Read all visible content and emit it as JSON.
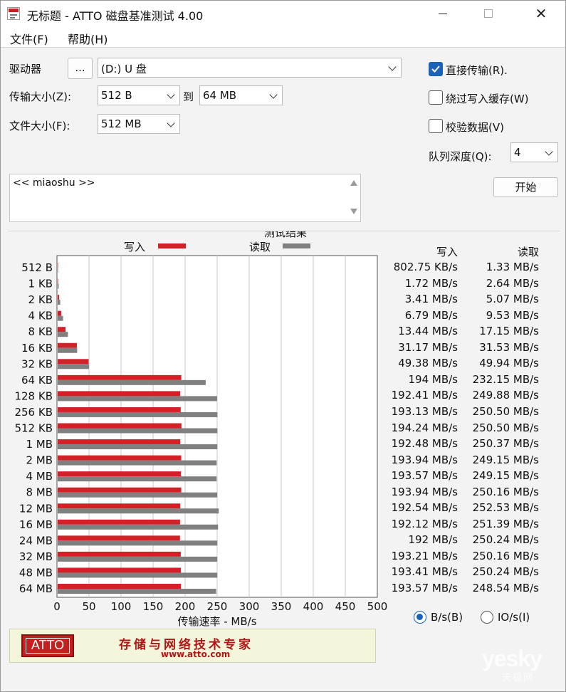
{
  "window": {
    "title": "无标题 - ATTO 磁盘基准测试 4.00",
    "close_glyph": "✕"
  },
  "menu": {
    "file": "文件(F)",
    "help": "帮助(H)"
  },
  "settings": {
    "drive_label": "驱动器",
    "browse_label": "...",
    "drive_value": "(D:) U 盘",
    "transfer_size_label": "传输大小(Z):",
    "transfer_from": "512 B",
    "to_label": "到",
    "transfer_to": "64 MB",
    "file_size_label": "文件大小(F):",
    "file_size": "512 MB",
    "direct_io_label": "直接传输(R).",
    "direct_io_checked": true,
    "bypass_cache_label": "绕过写入缓存(W)",
    "bypass_cache_checked": false,
    "verify_label": "校验数据(V)",
    "verify_checked": false,
    "queue_depth_label": "队列深度(Q):",
    "queue_depth": "4",
    "start_label": "开始"
  },
  "description": "<< miaoshu >>",
  "results": {
    "title": "测试结果",
    "write_header": "写入",
    "read_header": "读取",
    "unit_bs_label": "B/s(B)",
    "unit_ios_label": "IO/s(I)",
    "unit_selected": "B/s"
  },
  "chart_data": {
    "type": "bar",
    "orientation": "horizontal",
    "title": "测试结果",
    "xlabel": "传输速率 - MB/s",
    "xlim": [
      0,
      500
    ],
    "xticks": [
      0,
      50,
      100,
      150,
      200,
      250,
      300,
      350,
      400,
      450,
      500
    ],
    "grid": true,
    "legend": "top",
    "categories": [
      "512 B",
      "1 KB",
      "2 KB",
      "4 KB",
      "8 KB",
      "16 KB",
      "32 KB",
      "64 KB",
      "128 KB",
      "256 KB",
      "512 KB",
      "1 MB",
      "2 MB",
      "4 MB",
      "8 MB",
      "12 MB",
      "16 MB",
      "24 MB",
      "32 MB",
      "48 MB",
      "64 MB"
    ],
    "series": [
      {
        "name": "写入",
        "color": "#d42027",
        "values": [
          0.78,
          1.72,
          3.41,
          6.79,
          13.44,
          31.17,
          49.38,
          194,
          192.41,
          193.13,
          194.24,
          192.48,
          193.94,
          193.57,
          193.94,
          192.54,
          192.12,
          192,
          193.21,
          193.41,
          193.57
        ],
        "labels": [
          "802.75 KB/s",
          "1.72 MB/s",
          "3.41 MB/s",
          "6.79 MB/s",
          "13.44 MB/s",
          "31.17 MB/s",
          "49.38 MB/s",
          "194 MB/s",
          "192.41 MB/s",
          "193.13 MB/s",
          "194.24 MB/s",
          "192.48 MB/s",
          "193.94 MB/s",
          "193.57 MB/s",
          "193.94 MB/s",
          "192.54 MB/s",
          "192.12 MB/s",
          "192 MB/s",
          "193.21 MB/s",
          "193.41 MB/s",
          "193.57 MB/s"
        ]
      },
      {
        "name": "读取",
        "color": "#808080",
        "values": [
          1.33,
          2.64,
          5.07,
          9.53,
          17.15,
          31.53,
          49.94,
          232.15,
          249.88,
          250.5,
          250.5,
          250.37,
          249.15,
          249.15,
          250.16,
          252.53,
          251.39,
          250.24,
          250.16,
          250.24,
          248.54
        ],
        "labels": [
          "1.33 MB/s",
          "2.64 MB/s",
          "5.07 MB/s",
          "9.53 MB/s",
          "17.15 MB/s",
          "31.53 MB/s",
          "49.94 MB/s",
          "232.15 MB/s",
          "249.88 MB/s",
          "250.50 MB/s",
          "250.50 MB/s",
          "250.37 MB/s",
          "249.15 MB/s",
          "249.15 MB/s",
          "250.16 MB/s",
          "252.53 MB/s",
          "251.39 MB/s",
          "250.24 MB/s",
          "250.16 MB/s",
          "250.24 MB/s",
          "248.54 MB/s"
        ]
      }
    ]
  },
  "banner": {
    "logo": "ATTO",
    "slogan": "存储与网络技术专家",
    "url": "www.atto.com"
  },
  "watermark": {
    "brand": "yesky",
    "sub": "天极网"
  }
}
